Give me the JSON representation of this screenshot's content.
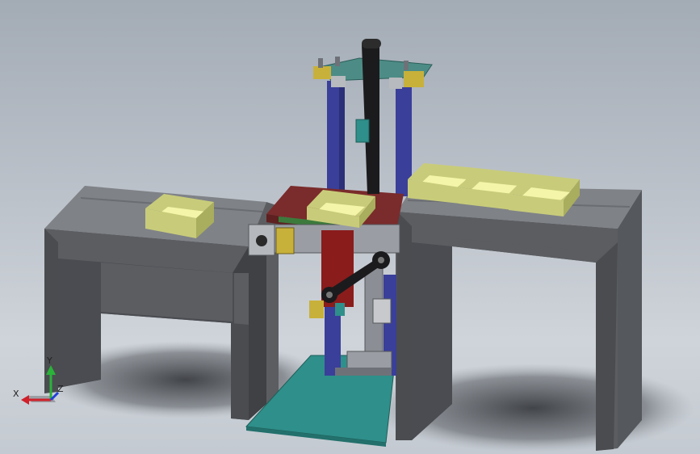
{
  "viewport": {
    "background_top": "#a3abb5",
    "background_bottom": "#cfd4da"
  },
  "triad": {
    "x_label": "X",
    "y_label": "Y",
    "z_label": "Z",
    "x_color": "#d0202a",
    "y_color": "#2bb23a",
    "z_color": "#2040d8"
  },
  "colors": {
    "frame_top": "#7f8287",
    "frame_front": "#5b5d61",
    "frame_side": "#4a4c50",
    "tray_outer": "#c8cc7a",
    "tray_inner": "#f4f5a8",
    "column_blue": "#3a3f9a",
    "plate_teal": "#2f8f8a",
    "belt_black": "#1b1b1d",
    "bracket_yellow": "#c8b13a",
    "dark_red": "#7a2b2b",
    "red_plate": "#8a1c1c",
    "top_plate": "#4d8c86"
  }
}
